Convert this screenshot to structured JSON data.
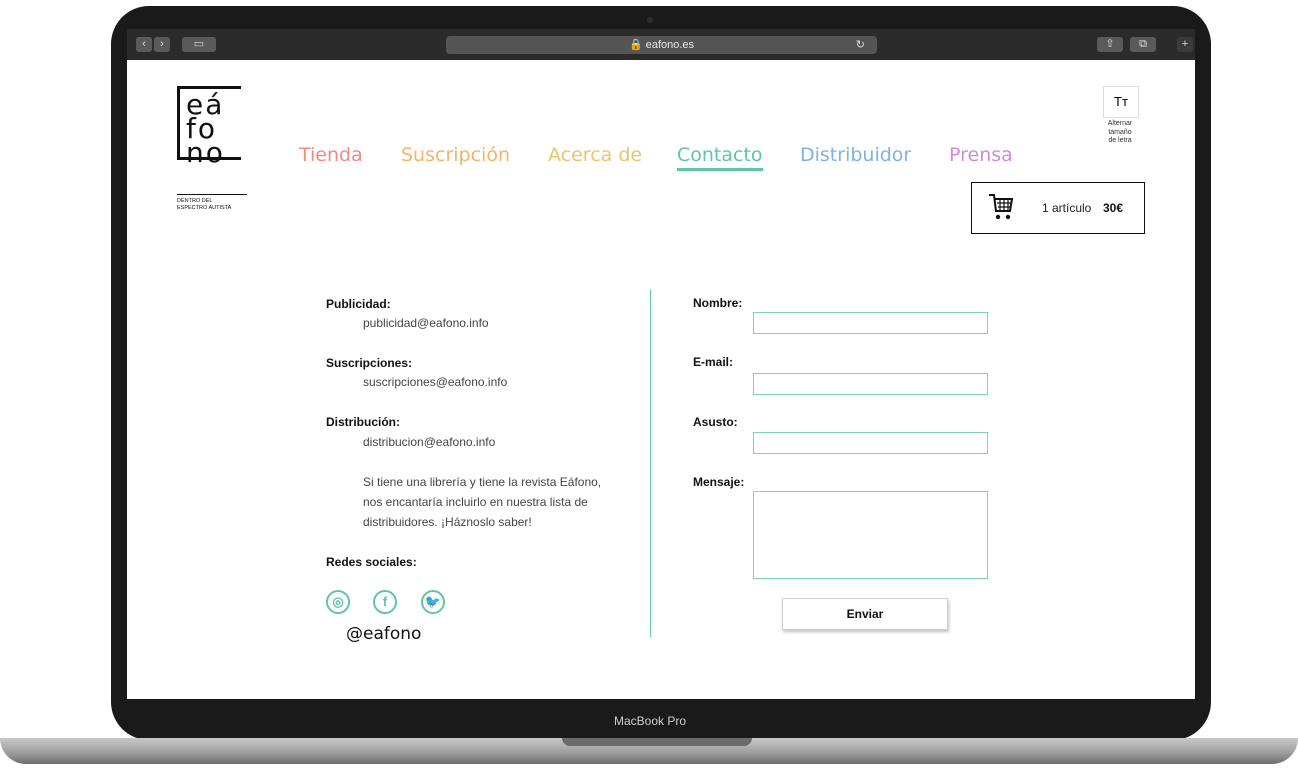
{
  "browser": {
    "url": "eafono.es",
    "lock_icon": "lock-icon",
    "reload_icon": "reload-icon"
  },
  "logo": {
    "line1": "eá",
    "line2": "fo",
    "line3": "no",
    "subtitle_1": "DENTRO DEL",
    "subtitle_2": "ESPECTRO AUTISTA"
  },
  "nav": {
    "items": [
      {
        "label": "Tienda",
        "color": "#f08a84"
      },
      {
        "label": "Suscripción",
        "color": "#f5b36b"
      },
      {
        "label": "Acerca de",
        "color": "#e8c66a"
      },
      {
        "label": "Contacto",
        "color": "#5fc4a8"
      },
      {
        "label": "Distribuidor",
        "color": "#7fb2e3"
      },
      {
        "label": "Prensa",
        "color": "#d08ad6"
      }
    ],
    "active": "Contacto"
  },
  "font_toggle": {
    "icon": "Tт",
    "label_1": "Alternar",
    "label_2": "tamaño",
    "label_3": "de letra"
  },
  "cart": {
    "count_label": "1 artículo",
    "total": "30€"
  },
  "contacts": {
    "publicidad_label": "Publicidad:",
    "publicidad_email": "publicidad@eafono.info",
    "suscripciones_label": "Suscripciones:",
    "suscripciones_email": "suscripciones@eafono.info",
    "distribucion_label": "Distribución:",
    "distribucion_email": "distribucion@eafono.info",
    "distribucion_note_1": "Si tiene una librería y tiene la revista Eáfono,",
    "distribucion_note_2": "nos encantaría incluirlo en nuestra lista de",
    "distribucion_note_3": "distribuidores. ¡Háznoslo saber!",
    "social_label": "Redes sociales:",
    "social_handle": "@eafono"
  },
  "form": {
    "name_label": "Nombre:",
    "email_label": "E-mail:",
    "subject_label": "Asusto:",
    "message_label": "Mensaje:",
    "submit_label": "Enviar"
  },
  "device": {
    "label": "MacBook Pro"
  },
  "accent_color": "#5fc4a8"
}
